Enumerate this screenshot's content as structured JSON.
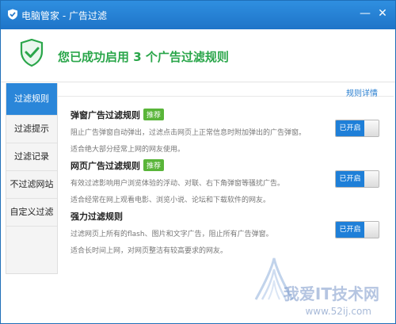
{
  "window": {
    "title": "电脑管家 - 广告过滤",
    "minimize_icon": "minimize-icon",
    "close_icon": "close-icon"
  },
  "header": {
    "icon": "shield-check-icon",
    "headline": "您已成功启用 3 个广告过滤规则"
  },
  "sidebar": {
    "items": [
      {
        "label": "过滤规则",
        "active": true
      },
      {
        "label": "过滤提示",
        "active": false
      },
      {
        "label": "过滤记录",
        "active": false
      },
      {
        "label": "不过滤网站",
        "active": false
      },
      {
        "label": "自定义过滤",
        "active": false
      }
    ]
  },
  "content": {
    "details_link": "规则详情",
    "rules": [
      {
        "name": "弹窗广告过滤规则",
        "badge": "推荐",
        "desc": "阻止广告弹窗自动弹出，过滤点击网页上正常信息时附加弹出的广告弹窗。",
        "desc2": "适合绝大部分经常上网的网友使用。",
        "toggle": "已开启"
      },
      {
        "name": "网页广告过滤规则",
        "badge": "推荐",
        "desc": "有效过滤影响用户浏览体验的浮动、对联、右下角弹窗等骚扰广告。",
        "desc2": "适合经常在网上观看电影、浏览小说、论坛和下载软件的网友。",
        "toggle": "已开启"
      },
      {
        "name": "强力过滤规则",
        "badge": "",
        "desc": "过滤网页上所有的flash、图片和文字广告，阻止所有广告弹窗。",
        "desc2": "适合长时间上网，对网页整洁有较高要求的网友。",
        "toggle": "已开启"
      }
    ]
  },
  "watermark": {
    "text": "我爱IT技术网",
    "url": "www.52ij.com"
  },
  "colors": {
    "titlebar": "#1e74c8",
    "headline": "#2aa64a",
    "nav_active": "#2a86d9",
    "badge": "#59b539",
    "toggle_on": "#1e7fd8"
  }
}
